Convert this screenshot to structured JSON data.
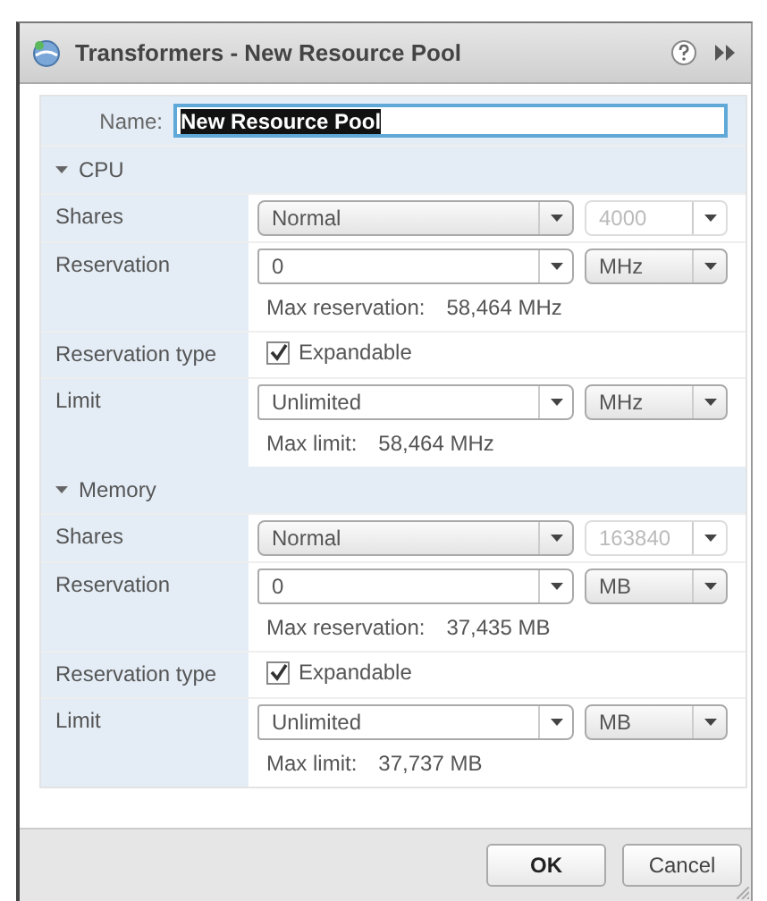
{
  "window": {
    "title": "Transformers - New Resource Pool"
  },
  "name_field": {
    "label": "Name:",
    "value": "New Resource Pool"
  },
  "sections": [
    {
      "title": "CPU",
      "expanded": true,
      "rows": [
        {
          "kind": "dropdowns",
          "label": "Shares",
          "field": {
            "value": "Normal",
            "editable": false
          },
          "unit": {
            "value": "4000",
            "disabled": true
          }
        },
        {
          "kind": "dropdowns",
          "label": "Reservation",
          "field": {
            "value": "0",
            "editable": true
          },
          "unit": {
            "value": "MHz",
            "disabled": false
          },
          "note": {
            "label": "Max reservation:",
            "value": "58,464 MHz"
          }
        },
        {
          "kind": "checkbox",
          "label": "Reservation type",
          "option": {
            "label": "Expandable",
            "checked": true
          }
        },
        {
          "kind": "dropdowns",
          "label": "Limit",
          "field": {
            "value": "Unlimited",
            "editable": true
          },
          "unit": {
            "value": "MHz",
            "disabled": false
          },
          "note": {
            "label": "Max limit:",
            "value": "58,464 MHz"
          }
        }
      ]
    },
    {
      "title": "Memory",
      "expanded": true,
      "rows": [
        {
          "kind": "dropdowns",
          "label": "Shares",
          "field": {
            "value": "Normal",
            "editable": false
          },
          "unit": {
            "value": "163840",
            "disabled": true
          }
        },
        {
          "kind": "dropdowns",
          "label": "Reservation",
          "field": {
            "value": "0",
            "editable": true
          },
          "unit": {
            "value": "MB",
            "disabled": false
          },
          "note": {
            "label": "Max reservation:",
            "value": "37,435 MB"
          }
        },
        {
          "kind": "checkbox",
          "label": "Reservation type",
          "option": {
            "label": "Expandable",
            "checked": true
          }
        },
        {
          "kind": "dropdowns",
          "label": "Limit",
          "field": {
            "value": "Unlimited",
            "editable": true
          },
          "unit": {
            "value": "MB",
            "disabled": false
          },
          "note": {
            "label": "Max limit:",
            "value": "37,737 MB"
          }
        }
      ]
    }
  ],
  "buttons": [
    {
      "label": "OK",
      "kind": "primary"
    },
    {
      "label": "Cancel",
      "kind": "secondary"
    }
  ]
}
